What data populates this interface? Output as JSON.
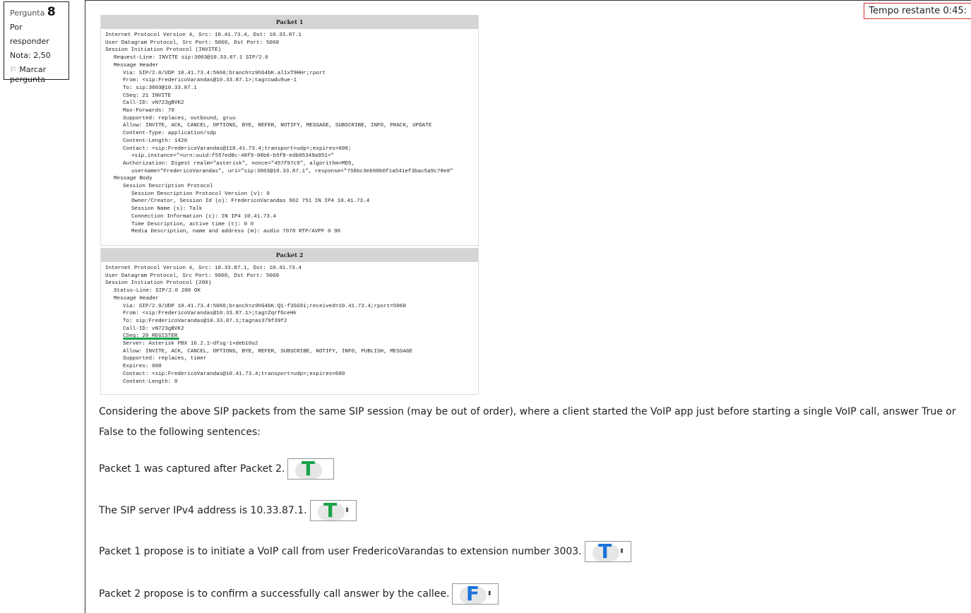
{
  "info": {
    "question_label": "Pergunta",
    "question_number": "8",
    "status": "Por responder",
    "grade": "Nota: 2,50",
    "flag_label": "Marcar pergunta"
  },
  "timer": "Tempo restante 0:45:",
  "packets": [
    {
      "title": "Packet 1",
      "lines": [
        {
          "l": 0,
          "t": "Internet Protocol Version 4, Src: 10.41.73.4, Dst: 10.33.87.1"
        },
        {
          "l": 0,
          "t": "User Datagram Protocol, Src Port: 5060, Dst Port: 5060"
        },
        {
          "l": 0,
          "t": "Session Initiation Protocol (INVITE)"
        },
        {
          "l": 1,
          "t": "Request-Line: INVITE sip:3003@10.33.87.1 SIP/2.0"
        },
        {
          "l": 1,
          "t": "Message Header"
        },
        {
          "l": 2,
          "t": "Via: SIP/2.0/UDP 10.41.73.4:5060;branch=z9hG4bK.al1xT9HHr;rport"
        },
        {
          "l": 2,
          "t": "From: <sip:FredericoVarandas@10.33.87.1>;tag=cwdu9ue-1"
        },
        {
          "l": 2,
          "t": "To: sip:3003@10.33.87.1"
        },
        {
          "l": 2,
          "t": "CSeq: 21 INVITE"
        },
        {
          "l": 2,
          "t": "Call-ID: vN723gBVK2"
        },
        {
          "l": 2,
          "t": "Max-Forwards: 70"
        },
        {
          "l": 2,
          "t": "Supported: replaces, outbound, gruu"
        },
        {
          "l": 2,
          "t": "Allow: INVITE, ACK, CANCEL, OPTIONS, BYE, REFER, NOTIFY, MESSAGE, SUBSCRIBE, INFO, PRACK, UPDATE"
        },
        {
          "l": 2,
          "t": "Content-Type: application/sdp"
        },
        {
          "l": 2,
          "t": "Content-Length: 1420"
        },
        {
          "l": 2,
          "t": "Contact: <sip:FredericoVarandas@110.41.73.4;transport=udp>;expires=600;"
        },
        {
          "l": 3,
          "t": "+sip.instance=\"<urn:uuid:f557ed8c-48f9-00b6-b5f8-edb85349a951>\""
        },
        {
          "l": 2,
          "t": "Authorization: Digest realm=\"asterisk\", nonce=\"457f97c9\", algorithm=MD5,"
        },
        {
          "l": 3,
          "t": "username=\"FredericoVarandas\", uri=\"sip:3003@10.33.87.1\", response=\"758bc3eb90b0f1a541ef3bac5a9c78e8\""
        },
        {
          "l": 1,
          "t": "Message Body"
        },
        {
          "l": 2,
          "t": "Session Description Protocol"
        },
        {
          "l": 3,
          "t": "Session Description Protocol Version (v): 0"
        },
        {
          "l": 3,
          "t": "Owner/Creator, Session Id (o): FredericoVarandas 962 751 IN IP4 10.41.73.4"
        },
        {
          "l": 3,
          "t": "Session Name (s): Talk"
        },
        {
          "l": 3,
          "t": "Connection Information (c): IN IP4 10.41.73.4"
        },
        {
          "l": 3,
          "t": "Time Description, active time (t): 0 0"
        },
        {
          "l": 3,
          "t": "Media Description, name and address (m): audio 7078 RTP/AVPF 0 96"
        }
      ]
    },
    {
      "title": "Packet 2",
      "lines": [
        {
          "l": 0,
          "t": "Internet Protocol Version 4, Src: 10.33.87.1, Dst: 10.41.73.4"
        },
        {
          "l": 0,
          "t": "User Datagram Protocol, Src Port: 5060, Dst Port: 5060"
        },
        {
          "l": 0,
          "t": "Session Initiation Protocol (200)"
        },
        {
          "l": 1,
          "t": "Status-Line: SIP/2.0 200 OK"
        },
        {
          "l": 1,
          "t": "Message Header"
        },
        {
          "l": 2,
          "t": "Via: SIP/2.0/UDP 10.41.73.4:5060;branch=z9hG4bK.Q1-f3SG9i;received=10.41.73.4;rport=5060"
        },
        {
          "l": 2,
          "t": "From: <sip:FredericoVarandas@10.33.87.1>;tag=ZqrfGceHk"
        },
        {
          "l": 2,
          "t": "To: sip:FredericoVarandas@10.33.87.1;tag=as379f39f2"
        },
        {
          "l": 2,
          "t": "Call-ID: vN723gBVK2"
        },
        {
          "l": 2,
          "t": "CSeq: 20 REGISTER"
        },
        {
          "l": 2,
          "t": "Server: Asterisk PBX 16.2.1~dfsg-1+deb10u2"
        },
        {
          "l": 2,
          "t": "Allow: INVITE, ACK, CANCEL, OPTIONS, BYE, REFER, SUBSCRIBE, NOTIFY, INFO, PUBLISH, MESSAGE"
        },
        {
          "l": 2,
          "t": "Supported: replaces, timer"
        },
        {
          "l": 2,
          "t": "Expires: 600"
        },
        {
          "l": 2,
          "t": "Contact: <sip:FredericoVarandas@10.41.73.4;transport=udp>;expires=600"
        },
        {
          "l": 2,
          "t": "Content-Length: 0"
        }
      ]
    }
  ],
  "question": "Considering the above SIP packets from the same SIP session (may be out of order), where a client started the VoIP app just before starting a single VoIP call, answer True or False to the following sentences:",
  "sentences": [
    {
      "text": "Packet 1 was captured after Packet 2.",
      "mark": "T",
      "color": "#1aa34a",
      "arrows": false
    },
    {
      "text": "The SIP server IPv4 address is 10.33.87.1.",
      "mark": "T",
      "color": "#1aa34a",
      "arrows": true
    },
    {
      "text": "Packet 1 propose is to initiate a VoIP call from user FredericoVarandas to extension number 3003.",
      "mark": "T",
      "color": "#1a73d9",
      "arrows": true
    },
    {
      "text": "Packet 2 propose is to confirm a successfully call answer by the callee.",
      "mark": "F",
      "color": "#1a73d9",
      "arrows": true
    }
  ]
}
